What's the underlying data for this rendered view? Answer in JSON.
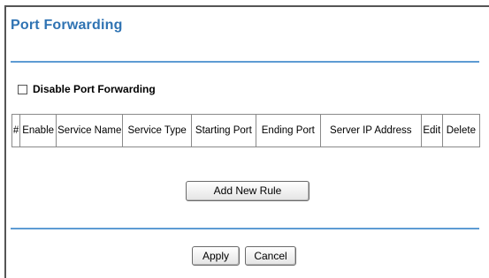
{
  "page": {
    "title": "Port Forwarding"
  },
  "disable_option": {
    "label": "Disable Port Forwarding",
    "checked": false
  },
  "table": {
    "headers": [
      "#",
      "Enable",
      "Service Name",
      "Service Type",
      "Starting Port",
      "Ending Port",
      "Server IP Address",
      "Edit",
      "Delete"
    ],
    "rows": []
  },
  "buttons": {
    "add_new_rule": "Add New Rule",
    "apply": "Apply",
    "cancel": "Cancel"
  },
  "colors": {
    "title": "#2f73b3",
    "rule": "#5d9bd3"
  }
}
